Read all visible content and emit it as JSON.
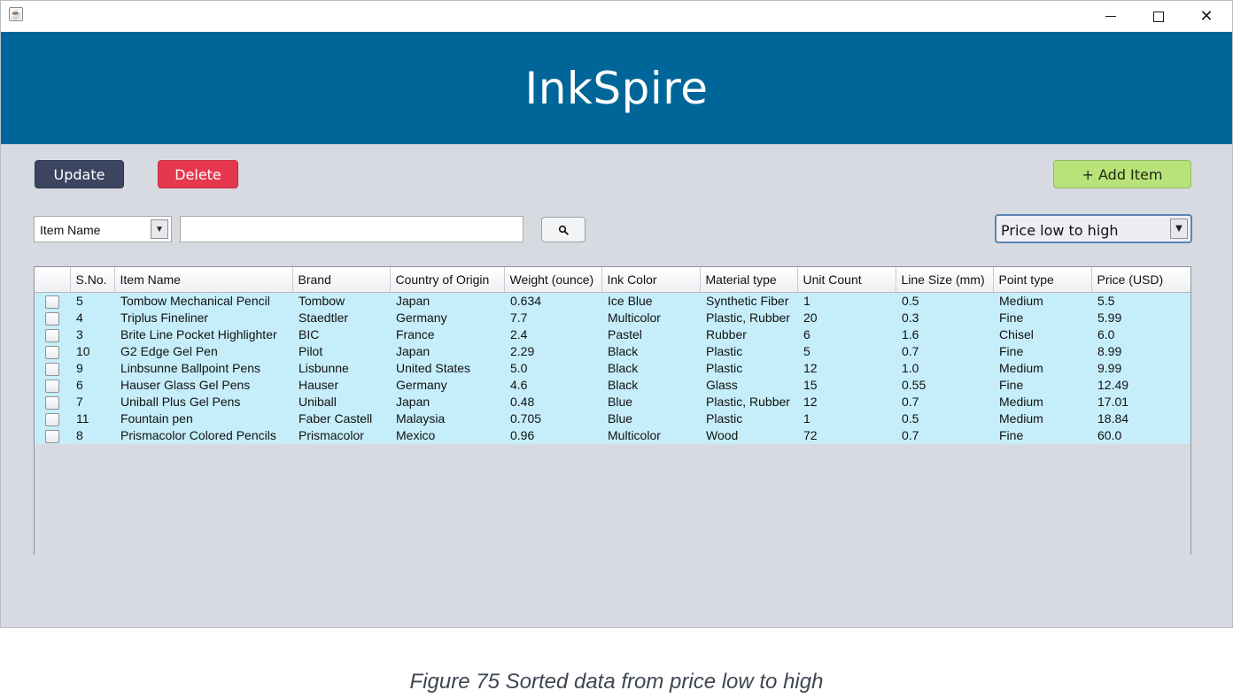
{
  "window": {
    "icon": "java-icon"
  },
  "header": {
    "title": "InkSpire"
  },
  "toolbar": {
    "update_label": "Update",
    "delete_label": "Delete",
    "add_label": "+ Add Item"
  },
  "filter": {
    "selected": "Item Name",
    "search_value": "",
    "search_icon": "search-icon"
  },
  "sort": {
    "selected": "Price low to high"
  },
  "table": {
    "columns": [
      "",
      "S.No.",
      "Item Name",
      "Brand",
      "Country of Origin",
      "Weight (ounce)",
      "Ink Color",
      "Material type",
      "Unit Count",
      "Line Size (mm)",
      "Point type",
      "Price (USD)"
    ],
    "rows": [
      [
        "5",
        "Tombow Mechanical Pencil",
        "Tombow",
        "Japan",
        "0.634",
        "Ice Blue",
        "Synthetic Fiber",
        "1",
        "0.5",
        "Medium",
        "5.5"
      ],
      [
        "4",
        "Triplus Fineliner",
        "Staedtler",
        "Germany",
        "7.7",
        "Multicolor",
        "Plastic, Rubber",
        "20",
        "0.3",
        "Fine",
        "5.99"
      ],
      [
        "3",
        "Brite Line Pocket Highlighter",
        "BIC",
        "France",
        "2.4",
        "Pastel",
        "Rubber",
        "6",
        "1.6",
        "Chisel",
        "6.0"
      ],
      [
        "10",
        "G2 Edge Gel Pen",
        "Pilot",
        "Japan",
        "2.29",
        "Black",
        "Plastic",
        "5",
        "0.7",
        "Fine",
        "8.99"
      ],
      [
        "9",
        "Linbsunne Ballpoint Pens",
        "Lisbunne",
        "United States",
        "5.0",
        "Black",
        "Plastic",
        "12",
        "1.0",
        "Medium",
        "9.99"
      ],
      [
        "6",
        "Hauser Glass Gel Pens",
        "Hauser",
        "Germany",
        "4.6",
        "Black",
        "Glass",
        "15",
        "0.55",
        "Fine",
        "12.49"
      ],
      [
        "7",
        "Uniball Plus Gel Pens",
        "Uniball",
        "Japan",
        "0.48",
        "Blue",
        "Plastic, Rubber",
        "12",
        "0.7",
        "Medium",
        "17.01"
      ],
      [
        "11",
        "Fountain pen",
        "Faber Castell",
        "Malaysia",
        "0.705",
        "Blue",
        "Plastic",
        "1",
        "0.5",
        "Medium",
        "18.84"
      ],
      [
        "8",
        "Prismacolor Colored Pencils",
        "Prismacolor",
        "Mexico",
        "0.96",
        "Multicolor",
        "Wood",
        "72",
        "0.7",
        "Fine",
        "60.0"
      ]
    ]
  },
  "caption": "Figure 75 Sorted data from price low to high",
  "colors": {
    "header_bg": "#006699",
    "update_bg": "#3b4560",
    "delete_bg": "#e5384f",
    "add_bg": "#b8e27a",
    "row_bg": "#c6eefa"
  }
}
